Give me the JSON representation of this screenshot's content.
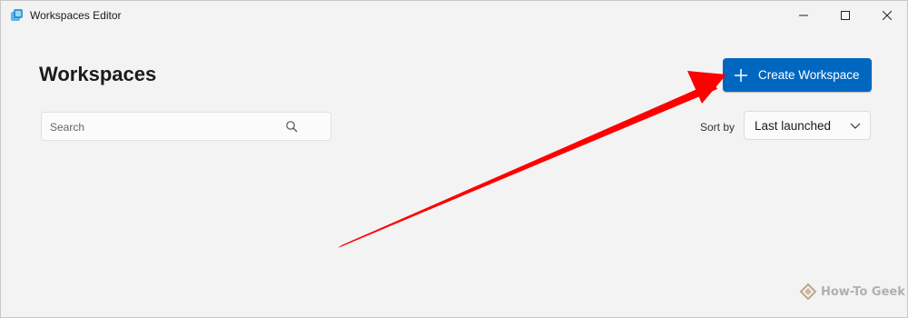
{
  "window": {
    "title": "Workspaces Editor",
    "controls": {
      "minimize": "minimize-icon",
      "maximize": "maximize-icon",
      "close": "close-icon"
    }
  },
  "main": {
    "page_title": "Workspaces",
    "create_button_label": "Create Workspace",
    "search": {
      "placeholder": "Search",
      "value": ""
    },
    "sort": {
      "label": "Sort by",
      "selected": "Last launched"
    }
  },
  "annotation": {
    "arrow_color": "#ff0000"
  },
  "watermark": {
    "text": "How-To Geek"
  },
  "colors": {
    "accent": "#0067c0",
    "background": "#f3f3f3"
  }
}
